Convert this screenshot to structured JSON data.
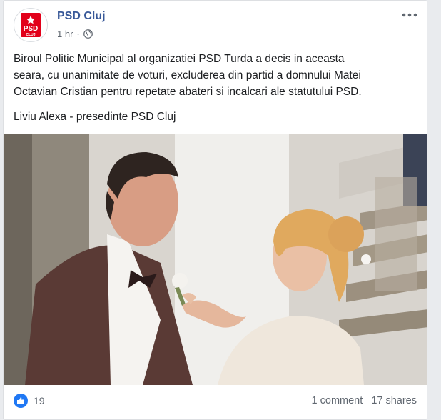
{
  "post": {
    "page_name": "PSD Cluj",
    "time": "1 hr",
    "dot": "·",
    "audience_icon": "globe-icon",
    "more_icon": "ellipsis-icon",
    "avatar": {
      "logo_text": "PSD",
      "logo_sub": "CLUJ",
      "logo_color": "#e2001a"
    },
    "body_lines": [
      "Biroul Politic Municipal al organizatiei PSD Turda a decis in aceasta",
      "seara, cu unanimitate de voturi, excluderea din partid a domnului Matei",
      "Octavian Cristian pentru repetate abateri si incalcari ale statutului PSD."
    ],
    "signature": "Liviu Alexa - presedinte PSD Cluj",
    "photo_description_icon": "photo-image"
  },
  "footer": {
    "like_icon": "thumbs-up-icon",
    "reaction_count": "19",
    "comments": "1 comment",
    "shares": "17 shares"
  },
  "colors": {
    "link": "#385898",
    "like_blue": "#2078f4",
    "text": "#1c1e21",
    "meta": "#606770"
  }
}
